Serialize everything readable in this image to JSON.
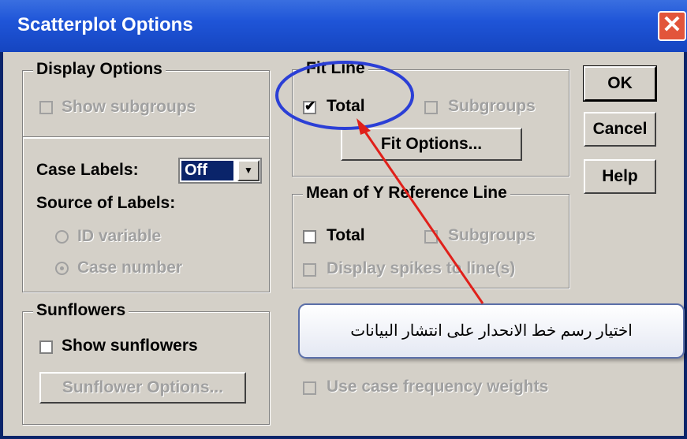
{
  "window": {
    "title": "Scatterplot Options",
    "close_glyph": "✕"
  },
  "display_options": {
    "title": "Display Options",
    "show_subgroups": {
      "label": "Show subgroups",
      "checked": false,
      "enabled": false
    }
  },
  "case_labels": {
    "label": "Case Labels:",
    "value": "Off",
    "source_title": "Source of Labels:",
    "radio_id": {
      "label": "ID variable",
      "selected": false,
      "enabled": false
    },
    "radio_case": {
      "label": "Case number",
      "selected": true,
      "enabled": false
    }
  },
  "sunflowers": {
    "title": "Sunflowers",
    "show_sunflowers": {
      "label": "Show sunflowers",
      "checked": false
    },
    "options_button": "Sunflower Options..."
  },
  "fit_line": {
    "title": "Fit Line",
    "total": {
      "label": "Total",
      "checked": true
    },
    "subgroups": {
      "label": "Subgroups",
      "checked": false,
      "enabled": false
    },
    "options_button": "Fit Options..."
  },
  "mean_y": {
    "title": "Mean of Y Reference Line",
    "total": {
      "label": "Total",
      "checked": false
    },
    "subgroups": {
      "label": "Subgroups",
      "checked": false,
      "enabled": false
    },
    "spikes": {
      "label": "Display spikes to line(s)",
      "checked": false,
      "enabled": false
    }
  },
  "case_frequency": {
    "label": "Use case frequency weights",
    "checked": false,
    "enabled": false
  },
  "buttons": {
    "ok": "OK",
    "cancel": "Cancel",
    "help": "Help"
  },
  "callout": {
    "text": "اختيار رسم خط الانحدار على انتشار البيانات"
  },
  "colors": {
    "highlight_ellipse": "#2b3fd6",
    "arrow": "#e0201a",
    "titlebar": "#1f55d8"
  }
}
